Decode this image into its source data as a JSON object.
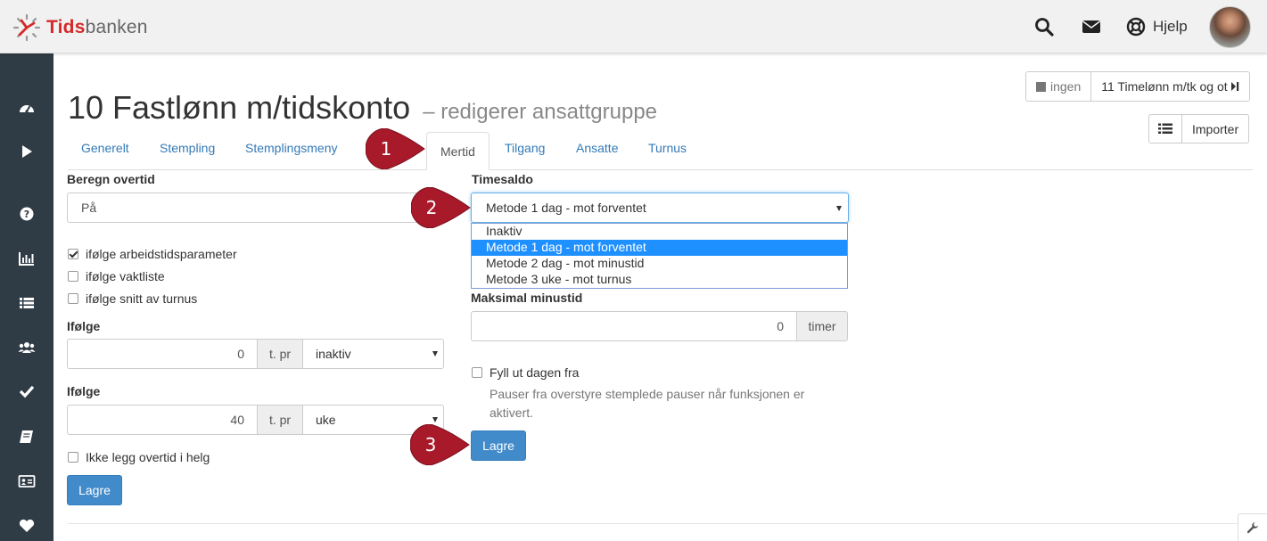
{
  "header": {
    "logo_text_red": "Tids",
    "logo_text_grey": "banken",
    "help_label": "Hjelp"
  },
  "sidebar": {
    "items": [
      "dashboard-icon",
      "play-icon",
      "question-icon",
      "bar-chart-icon",
      "list-icon",
      "users-icon",
      "checkmark-icon",
      "book-icon",
      "id-card-icon",
      "heart-icon"
    ]
  },
  "page": {
    "title": "10 Fastlønn m/tidskonto",
    "subtitle": "– redigerer ansattgruppe"
  },
  "nav_group": {
    "prev_label": "ingen",
    "next_label": "11 Timelønn m/tk og ot"
  },
  "import_button": "Importer",
  "tabs": [
    "Generelt",
    "Stempling",
    "Stemplingsmeny",
    "Mertid",
    "Tilgang",
    "Ansatte",
    "Turnus"
  ],
  "active_tab": "Mertid",
  "left": {
    "beregn_label": "Beregn overtid",
    "beregn_value": "På",
    "checkboxes": [
      {
        "label": "ifølge arbeidstidsparameter",
        "checked": true
      },
      {
        "label": "ifølge vaktliste",
        "checked": false
      },
      {
        "label": "ifølge snitt av turnus",
        "checked": false
      }
    ],
    "rule1": {
      "label": "Ifølge",
      "value": "0",
      "addon": "t. pr",
      "select": "inaktiv"
    },
    "rule2": {
      "label": "Ifølge",
      "value": "40",
      "addon": "t. pr",
      "select": "uke"
    },
    "weekend_checkbox": {
      "label": "Ikke legg overtid i helg",
      "checked": false
    },
    "save_label": "Lagre"
  },
  "right": {
    "timesaldo_label": "Timesaldo",
    "timesaldo_value": "Metode 1 dag - mot forventet",
    "options": [
      "Inaktiv",
      "Metode 1 dag - mot forventet",
      "Metode 2 dag - mot minustid",
      "Metode 3 uke - mot turnus"
    ],
    "selected_option": "Metode 1 dag - mot forventet",
    "maks_label": "Maksimal minustid",
    "maks_value": "0",
    "maks_addon": "timer",
    "fill_checkbox": {
      "label": "Fyll ut dagen fra",
      "checked": false
    },
    "note_line1": "Pauser fra overstyre stemplede pauser når funksjonen er",
    "note_line2": "aktivert.",
    "save_label": "Lagre"
  },
  "callouts": [
    "1",
    "2",
    "3"
  ],
  "colors": {
    "sidebar": "#2f3b45",
    "primary": "#428bca",
    "link": "#337ab7",
    "callout": "#a8192a",
    "selected_option": "#1e90ff",
    "logo_red": "#d32a2a"
  }
}
